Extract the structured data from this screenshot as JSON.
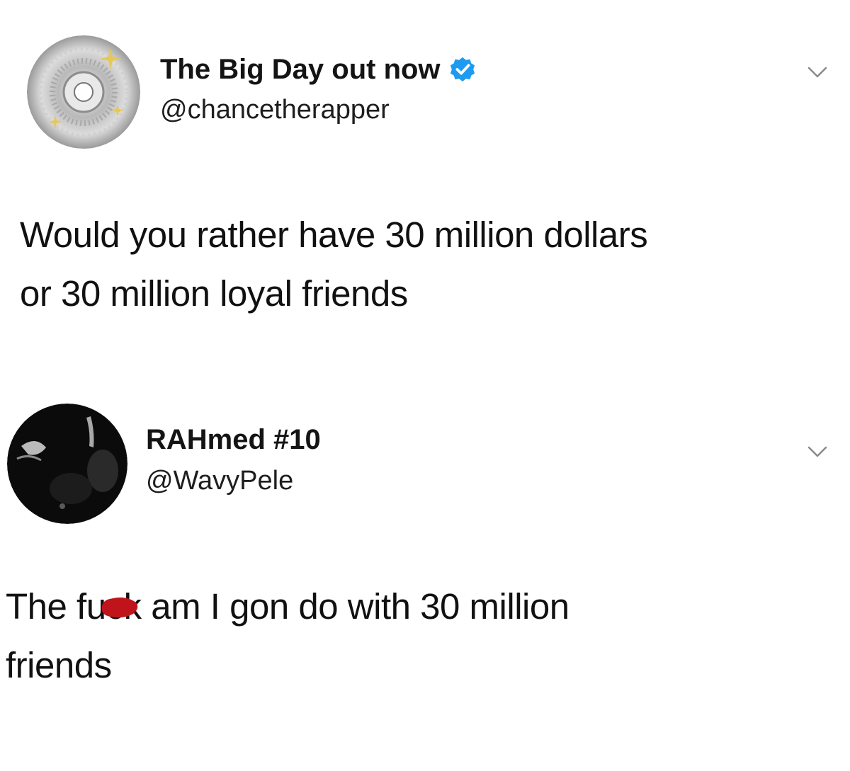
{
  "tweets": [
    {
      "display_name": "The Big Day out now",
      "verified": true,
      "handle": "@chancetherapper",
      "avatar_icon": "disc-avatar-icon",
      "menu_icon": "chevron-down-icon",
      "text_lines": [
        "Would you rather have 30 million dollars",
        "or 30 million loyal friends"
      ]
    },
    {
      "display_name": "RAHmed #10",
      "verified": false,
      "handle": "@WavyPele",
      "avatar_icon": "dark-photo-avatar-icon",
      "menu_icon": "chevron-down-icon",
      "text_lines": {
        "line1_before": "The f",
        "line1_censored": "uck",
        "line1_after": " am I gon do with 30 million",
        "line2": "friends"
      }
    }
  ],
  "colors": {
    "verified_blue": "#1d9bf0",
    "censor_red": "#c0141c",
    "chevron_gray": "#8a8a8a"
  }
}
